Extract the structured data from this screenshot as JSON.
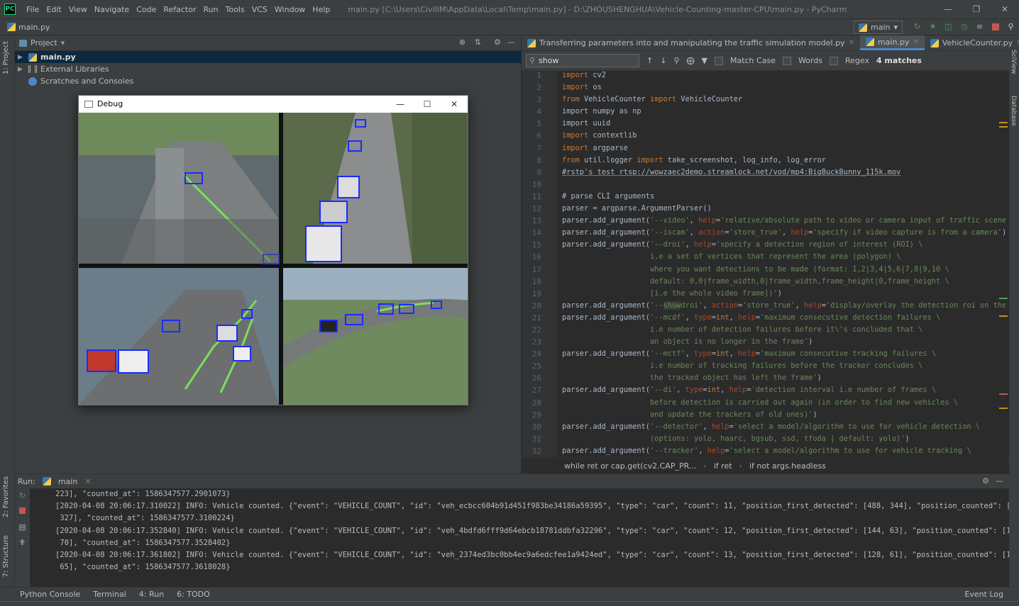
{
  "app": {
    "title": "main.py [C:\\Users\\CivilIM\\AppData\\Local\\Temp\\main.py] - D:\\ZHOUSHENGHUA\\Vehicle-Counting-master-CPU\\main.py - PyCharm",
    "logo": "PC"
  },
  "menu": [
    "File",
    "Edit",
    "View",
    "Navigate",
    "Code",
    "Refactor",
    "Run",
    "Tools",
    "VCS",
    "Window",
    "Help"
  ],
  "navbar": {
    "file": "main.py",
    "run_config": "main"
  },
  "left_strip": {
    "project": "1: Project",
    "favorites": "2: Favorites",
    "structure": "7: Structure"
  },
  "right_strip": {
    "sciview": "SciView",
    "database": "Database"
  },
  "project": {
    "header": "Project",
    "items": [
      {
        "label": "main.py"
      },
      {
        "label": "External Libraries"
      },
      {
        "label": "Scratches and Consoles"
      }
    ]
  },
  "debug_window": {
    "title": "Debug"
  },
  "editor": {
    "tabs": [
      {
        "label": "Transferring parameters into and manipulating the traffic simulation model.py"
      },
      {
        "label": "main.py"
      },
      {
        "label": "VehicleCounter.py"
      }
    ],
    "find": {
      "query": "show",
      "match_case": "Match Case",
      "words": "Words",
      "regex": "Regex",
      "count": "4 matches"
    },
    "breadcrumb": [
      "while ret or cap.get(cv2.CAP_PR...",
      "if ret",
      "if not args.headless"
    ]
  },
  "run": {
    "label": "Run:",
    "config": "main"
  },
  "console_lines": [
    "223], \"counted_at\": 1586347577.2901073}",
    "[2020-04-08 20:06:17.310022] INFO: Vehicle counted. {\"event\": \"VEHICLE_COUNT\", \"id\": \"veh_ecbcc604b91d451f983be34186a59395\", \"type\": \"car\", \"count\": 11, \"position_first_detected\": [488, 344], \"position_counted\": [531,",
    " 327], \"counted_at\": 1586347577.3100224}",
    "[2020-04-08 20:06:17.352840] INFO: Vehicle counted. {\"event\": \"VEHICLE_COUNT\", \"id\": \"veh_4bdfd6fff9d64ebcb18781ddbfa32296\", \"type\": \"car\", \"count\": 12, \"position_first_detected\": [144, 63], \"position_counted\": [155,",
    " 70], \"counted_at\": 1586347577.3528402}",
    "[2020-04-08 20:06:17.361802] INFO: Vehicle counted. {\"event\": \"VEHICLE_COUNT\", \"id\": \"veh_2374ed3bc0bb4ec9a6edcfee1a9424ed\", \"type\": \"car\", \"count\": 13, \"position_first_detected\": [128, 61], \"position_counted\": [132,",
    " 65], \"counted_at\": 1586347577.3618028}"
  ],
  "bottom_tabs": [
    "Python Console",
    "Terminal",
    "4: Run",
    "6: TODO"
  ],
  "event_log": "Event Log"
}
